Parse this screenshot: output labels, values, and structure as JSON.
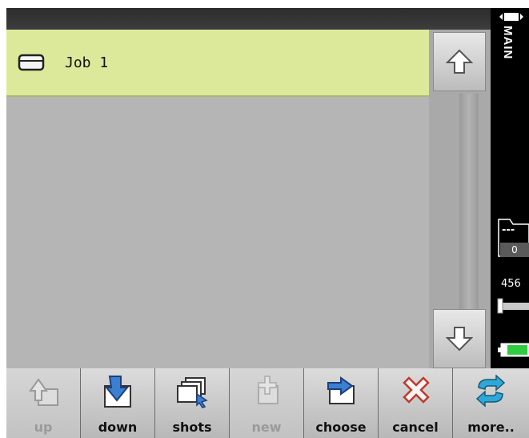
{
  "list": {
    "items": [
      {
        "label": "Job 1",
        "icon": "tray-icon",
        "selected": true
      }
    ]
  },
  "side_panel": {
    "mode_label": "MAIN",
    "folder_label": "---",
    "folder_count": "0",
    "shot_count": "456",
    "icons": [
      "battery-mini-icon",
      "folder-icon",
      "slider-icon",
      "battery-icon"
    ]
  },
  "toolbar": {
    "buttons": [
      {
        "label": "up",
        "icon": "folder-up-icon",
        "enabled": false
      },
      {
        "label": "down",
        "icon": "folder-down-icon",
        "enabled": true
      },
      {
        "label": "shots",
        "icon": "shots-icon",
        "enabled": true
      },
      {
        "label": "new",
        "icon": "new-folder-icon",
        "enabled": false
      },
      {
        "label": "choose",
        "icon": "choose-icon",
        "enabled": true
      },
      {
        "label": "cancel",
        "icon": "cancel-icon",
        "enabled": true
      },
      {
        "label": "more..",
        "icon": "more-icon",
        "enabled": true
      }
    ]
  },
  "colors": {
    "selected_row": "#dde99a",
    "list_background": "#b5b5b5",
    "battery": "#2ecc40"
  }
}
